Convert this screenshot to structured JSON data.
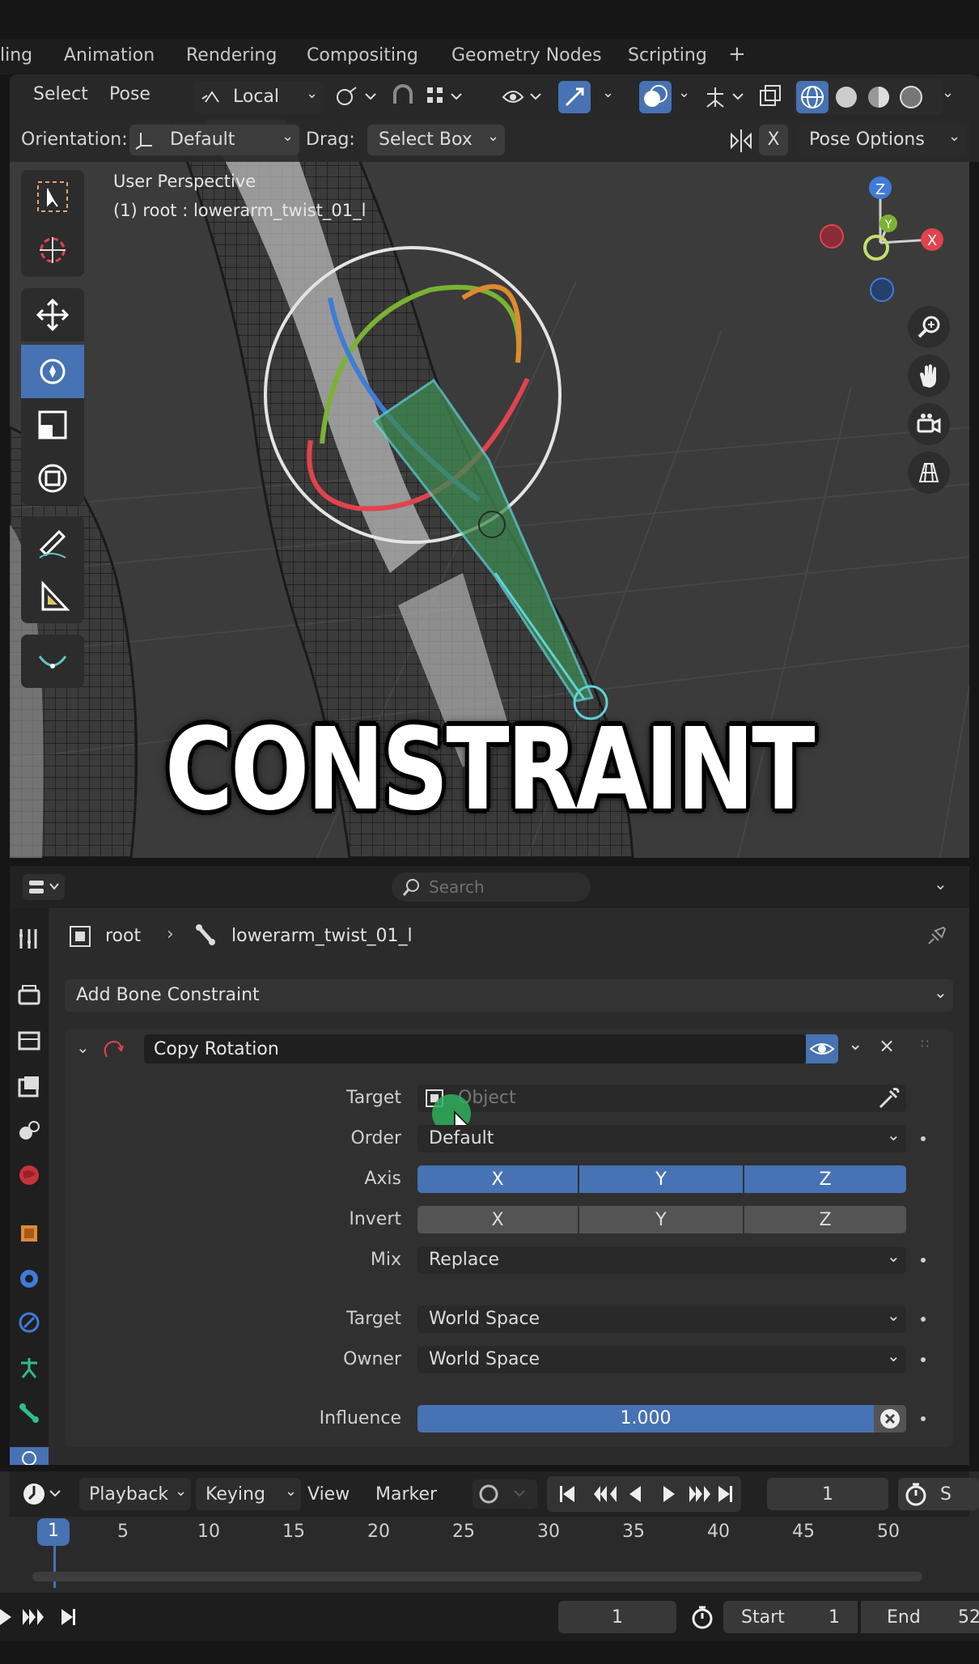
{
  "workspace_tabs": [
    "ling",
    "Animation",
    "Rendering",
    "Compositing",
    "Geometry Nodes",
    "Scripting"
  ],
  "add_tab_glyph": "+",
  "header": {
    "select": "Select",
    "pose": "Pose",
    "transform_orientation": "Local",
    "orientation_label": "Orientation:",
    "orientation_value": "Default",
    "drag_label": "Drag:",
    "drag_value": "Select Box",
    "x_mirror": "X",
    "pose_options": "Pose Options"
  },
  "viewport": {
    "perspective": "User Perspective",
    "object_info": "(1) root : lowerarm_twist_01_l",
    "gizmo_axes": [
      "Z",
      "Y",
      "X"
    ],
    "caption": "CONSTRAINT"
  },
  "properties": {
    "search_placeholder": "Search",
    "breadcrumb_root": "root",
    "breadcrumb_bone": "lowerarm_twist_01_l",
    "add_constraint": "Add Bone Constraint",
    "constraint_name": "Copy Rotation",
    "target_label": "Target",
    "target_placeholder": "Object",
    "order_label": "Order",
    "order_value": "Default",
    "axis_label": "Axis",
    "axis_x": "X",
    "axis_y": "Y",
    "axis_z": "Z",
    "invert_label": "Invert",
    "invert_x": "X",
    "invert_y": "Y",
    "invert_z": "Z",
    "mix_label": "Mix",
    "mix_value": "Replace",
    "target_space_label": "Target",
    "target_space_value": "World Space",
    "owner_space_label": "Owner",
    "owner_space_value": "World Space",
    "influence_label": "Influence",
    "influence_value": "1.000"
  },
  "timeline": {
    "menus": [
      "Playback",
      "Keying",
      "View",
      "Marker"
    ],
    "current_frame": "1",
    "ruler": [
      "1",
      "5",
      "10",
      "15",
      "20",
      "25",
      "30",
      "35",
      "40",
      "45",
      "50"
    ],
    "frame_field": "1",
    "start_label": "Start",
    "start_value": "1",
    "end_label": "End",
    "end_value": "52",
    "right_cut": "S"
  },
  "colors": {
    "accent": "#4772b3",
    "x_axis": "#e0434e",
    "y_axis": "#7ab233",
    "z_axis": "#3f7bd8",
    "bone_select": "#5fd3d7"
  }
}
